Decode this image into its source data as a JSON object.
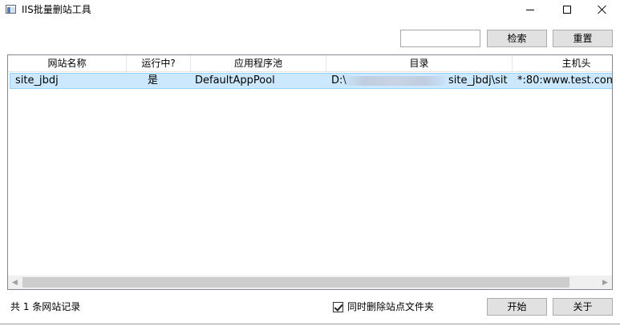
{
  "window": {
    "title": "IIS批量删站工具"
  },
  "search": {
    "value": "",
    "placeholder": "",
    "search_label": "检索",
    "reset_label": "重置"
  },
  "table": {
    "columns": [
      "网站名称",
      "运行中?",
      "应用程序池",
      "目录",
      "主机头"
    ],
    "rows": [
      {
        "name": "site_jbdj",
        "running": "是",
        "app_pool": "DefaultAppPool",
        "dir_prefix": "D:\\",
        "dir_suffix": "site_jbdj\\sit",
        "host": "*:80:www.test.com"
      }
    ]
  },
  "footer": {
    "status": "共 1 条网站记录",
    "delete_folder_label": "同时删除站点文件夹",
    "delete_folder_checked": true,
    "start_label": "开始",
    "about_label": "关于"
  }
}
